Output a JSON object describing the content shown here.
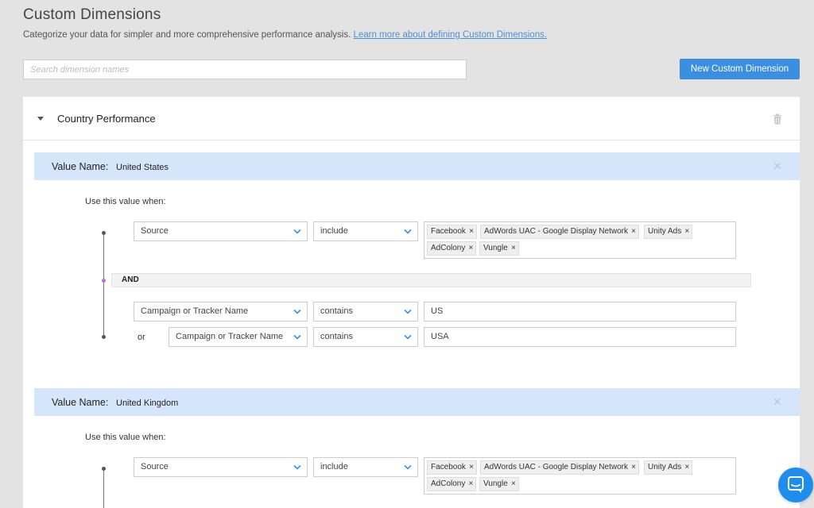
{
  "header": {
    "title": "Custom Dimensions",
    "subtitle": "Categorize your data for simpler and more comprehensive performance analysis.",
    "learn_more_link": "Learn more about defining Custom Dimensions."
  },
  "search": {
    "placeholder": "Search dimension names",
    "value": ""
  },
  "toolbar": {
    "new_button_label": "New Custom Dimension"
  },
  "colors": {
    "accent": "#3a8fe0",
    "value_header_bg": "#d5e6fa",
    "and_dot": "#b470d6"
  },
  "dimension": {
    "name": "Country Performance",
    "values": [
      {
        "label": "Value Name:",
        "name": "United States",
        "use_when": "Use this value when:",
        "condition1": {
          "field": "Source",
          "operator": "include",
          "tags": [
            "Facebook",
            "AdWords UAC - Google Display Network",
            "Unity Ads",
            "AdColony",
            "Vungle"
          ]
        },
        "and_label": "AND",
        "condition2": {
          "field": "Campaign or Tracker Name",
          "operator": "contains",
          "value": "US"
        },
        "or_label": "or",
        "condition3": {
          "field": "Campaign or Tracker Name",
          "operator": "contains",
          "value": "USA"
        }
      },
      {
        "label": "Value Name:",
        "name": "United Kingdom",
        "use_when": "Use this value when:",
        "condition1": {
          "field": "Source",
          "operator": "include",
          "tags": [
            "Facebook",
            "AdWords UAC - Google Display Network",
            "Unity Ads",
            "AdColony",
            "Vungle"
          ]
        }
      }
    ]
  },
  "icons": {
    "collapse": "caret-down-icon",
    "trash": "trash-icon",
    "close": "close-icon",
    "chevron": "chevron-down-icon",
    "chat": "chat-icon"
  }
}
